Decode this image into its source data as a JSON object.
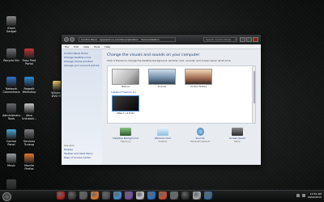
{
  "desktop": {
    "icons": [
      {
        "label": "iDash\nGadget",
        "color": "#8a8a8a"
      },
      {
        "label": "Recycle Bin",
        "color": "#6f7376"
      },
      {
        "label": "Easy Print\nPortal",
        "color": "#c23636"
      },
      {
        "label": "Network\nConnections",
        "color": "#3671c2"
      },
      {
        "label": "Regedit\nWorkshop",
        "color": "#2e8bd8"
      },
      {
        "label": "Administrato...\nTools",
        "color": "#666a6e"
      },
      {
        "label": "Aero\nUninstall...",
        "color": "#c8c8c8"
      },
      {
        "label": "Control\nPanel",
        "color": "#4aa6d6"
      },
      {
        "label": "Services\nTuneup",
        "color": "#7a7f83"
      },
      {
        "label": "Music",
        "color": "#9a9ea2"
      },
      {
        "label": "Mozilla\nFirefox",
        "color": "#e0782e"
      },
      {
        "label": "Windows\nDVD M...",
        "color": "#f0d070"
      },
      {
        "label": "GOM Player",
        "color": "#3e3e3e"
      }
    ]
  },
  "window": {
    "address": [
      "Control Panel",
      "Appearance and Personalization",
      "Personalization"
    ],
    "search_placeholder": "Search Control Panel",
    "menu": [
      "File",
      "Edit",
      "View",
      "Tools",
      "Help"
    ],
    "left_pane": {
      "links": [
        "Control Panel Home",
        "Change desktop icons",
        "Change mouse pointers",
        "Change your account picture"
      ],
      "see_also_title": "See also",
      "see_also": [
        "Display",
        "Taskbar and Start Menu",
        "Ease of Access Center"
      ]
    },
    "heading": "Change the visuals and sounds on your computer",
    "description": "Click a theme to change the desktop background, window color, sounds, and screen saver all at once.",
    "themes": [
      {
        "name": "Nature",
        "color": "#d8d8d8"
      },
      {
        "name": "Scenes",
        "color": "#9bb6d0"
      },
      {
        "name": "United States",
        "color": "#b29a8e"
      }
    ],
    "installed_group": "Installed Themes (1)",
    "installed_themes": [
      {
        "name": "xBlack v2.8 RC",
        "color": "#222222"
      }
    ],
    "bottom_items": [
      {
        "title": "Desktop Background",
        "sub": "Harmony",
        "color": "#3a7a3a"
      },
      {
        "title": "Window Color",
        "sub": "Custom",
        "color": "#9ccbe8"
      },
      {
        "title": "Sounds",
        "sub": "Windows Default",
        "color": "#5aa0d8"
      },
      {
        "title": "Screen Saver",
        "sub": "None",
        "color": "#5d5d5d"
      }
    ]
  },
  "taskbar": {
    "dock_colors": [
      "#b02020",
      "#3c3c3c",
      "#5a5a5a",
      "#e07a2e",
      "#4f4f4f",
      "#3f8fd0",
      "#7a4aa0",
      "#c7c7c7",
      "#2a72c2",
      "#d05030",
      "#6a6a6a",
      "#2f2f2f",
      "#aaaaaa",
      "#3a6a9a"
    ],
    "time": "12:51 AM",
    "date": "20/04/2010"
  }
}
